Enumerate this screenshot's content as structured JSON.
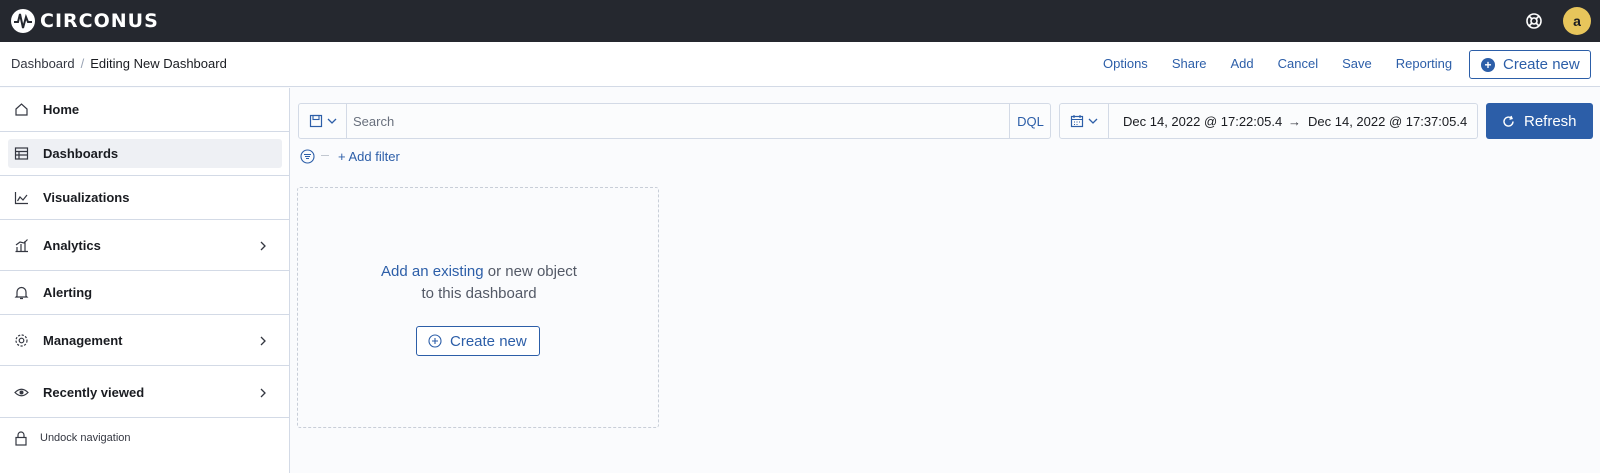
{
  "header": {
    "brand": "CIRCONUS",
    "avatar_initial": "a"
  },
  "breadcrumb": {
    "parent": "Dashboard",
    "separator": "/",
    "current": "Editing New Dashboard"
  },
  "top_actions": [
    "Options",
    "Share",
    "Add",
    "Cancel",
    "Save",
    "Reporting"
  ],
  "create_new_label": "Create new",
  "sidebar": {
    "items": [
      {
        "label": "Home",
        "icon": "home-icon"
      },
      {
        "label": "Dashboards",
        "icon": "dashboards-icon",
        "active": true
      },
      {
        "label": "Visualizations",
        "icon": "visualize-icon"
      },
      {
        "label": "Analytics",
        "icon": "analytics-icon",
        "expandable": true
      },
      {
        "label": "Alerting",
        "icon": "bell-icon"
      },
      {
        "label": "Management",
        "icon": "gear-icon",
        "expandable": true
      },
      {
        "label": "Recently viewed",
        "icon": "eye-icon",
        "expandable": true
      }
    ],
    "undock_label": "Undock navigation"
  },
  "query": {
    "search_placeholder": "Search",
    "language": "DQL",
    "start_date": "Dec 14, 2022 @ 17:22:05.4",
    "arrow": "→",
    "end_date": "Dec 14, 2022 @ 17:37:05.4",
    "refresh_label": "Refresh",
    "add_filter_label": "+ Add filter"
  },
  "empty_panel": {
    "link_text": "Add an existing",
    "text_rest": " or new object",
    "line2": "to this dashboard",
    "button_label": "Create new"
  },
  "colors": {
    "header_bg": "#25282f",
    "accent": "#2c5ea8",
    "avatar_bg": "#e7c55b"
  }
}
